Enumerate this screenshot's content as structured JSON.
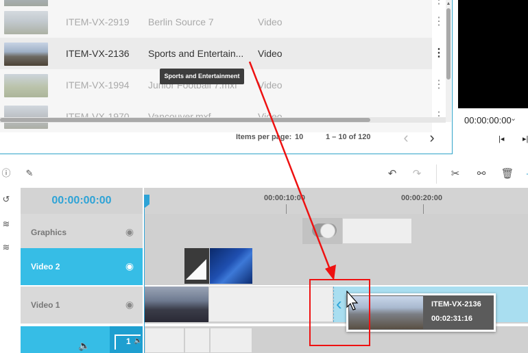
{
  "asset_list": {
    "rows": [
      {
        "id": "",
        "title": "",
        "type": "",
        "state": "dim"
      },
      {
        "id": "ITEM-VX-2919",
        "title": "Berlin Source 7",
        "type": "Video",
        "state": "dim"
      },
      {
        "id": "ITEM-VX-2136",
        "title": "Sports and Entertain...",
        "type": "Video",
        "state": "selected"
      },
      {
        "id": "ITEM-VX-1994",
        "title": "Junior Football 7.mxf",
        "type": "Video",
        "state": "dim"
      },
      {
        "id": "ITEM-VX-1970",
        "title": "Vancouver.mxf",
        "type": "Video",
        "state": "dim"
      }
    ],
    "tooltip": "Sports and Entertainment",
    "pagination": {
      "items_per_page_label": "Items per page:",
      "items_per_page": "10",
      "range": "1 – 10 of 120"
    }
  },
  "preview": {
    "timecode": "00:00:00:00"
  },
  "timeline": {
    "timecode": "00:00:00:00",
    "ruler_ticks": [
      "00:00:10:00",
      "00:00:20:00"
    ],
    "tracks": [
      {
        "name": "Graphics",
        "active": false
      },
      {
        "name": "Video 2",
        "active": true
      },
      {
        "name": "Video 1",
        "active": false
      }
    ],
    "audio_track_number": "1"
  },
  "drag_preview": {
    "item_id": "ITEM-VX-2136",
    "duration": "00:02:31:16"
  },
  "icons": {
    "sidebar": [
      "info-icon",
      "edit-icon",
      "history-icon",
      "add-layer-icon",
      "remove-layer-icon"
    ],
    "toolbar": [
      "undo-icon",
      "redo-icon",
      "cut-icon",
      "unlink-icon",
      "delete-icon"
    ]
  },
  "colors": {
    "accent": "#2ea3d6",
    "track_active": "#36bde6",
    "highlight_red": "#ee1111"
  }
}
